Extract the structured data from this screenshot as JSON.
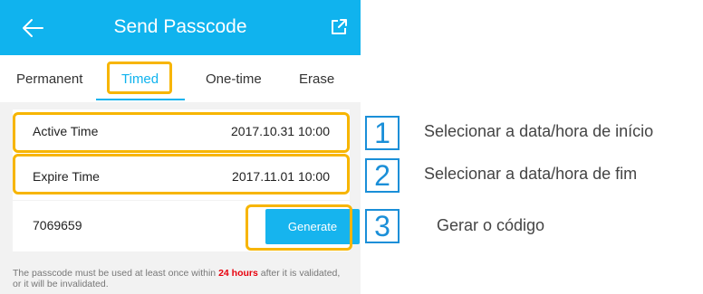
{
  "header": {
    "title": "Send Passcode",
    "back_icon": "arrow-left-icon",
    "share_icon": "share-icon",
    "color": "#10b3ee"
  },
  "tabs": [
    {
      "label": "Permanent",
      "active": false
    },
    {
      "label": "Timed",
      "active": true
    },
    {
      "label": "One-time",
      "active": false
    },
    {
      "label": "Erase",
      "active": false
    }
  ],
  "active_time": {
    "label": "Active Time",
    "value": "2017.10.31 10:00"
  },
  "expire_time": {
    "label": "Expire Time",
    "value": "2017.11.01 10:00"
  },
  "passcode": {
    "code": "7069659",
    "button_label": "Generate"
  },
  "note": {
    "before": "The passcode must be used at least once within ",
    "highlight": "24 hours",
    "after": " after it is validated, or it will be invalidated."
  },
  "callouts": [
    {
      "number": "1",
      "text": "Selecionar a data/hora de início"
    },
    {
      "number": "2",
      "text": "Selecionar a data/hora de fim"
    },
    {
      "number": "3",
      "text": "Gerar o código"
    }
  ],
  "colors": {
    "accent": "#10b3ee",
    "highlight_border": "#f7b500",
    "callout_blue": "#1a8fd8",
    "warning_red": "#e8000d"
  }
}
